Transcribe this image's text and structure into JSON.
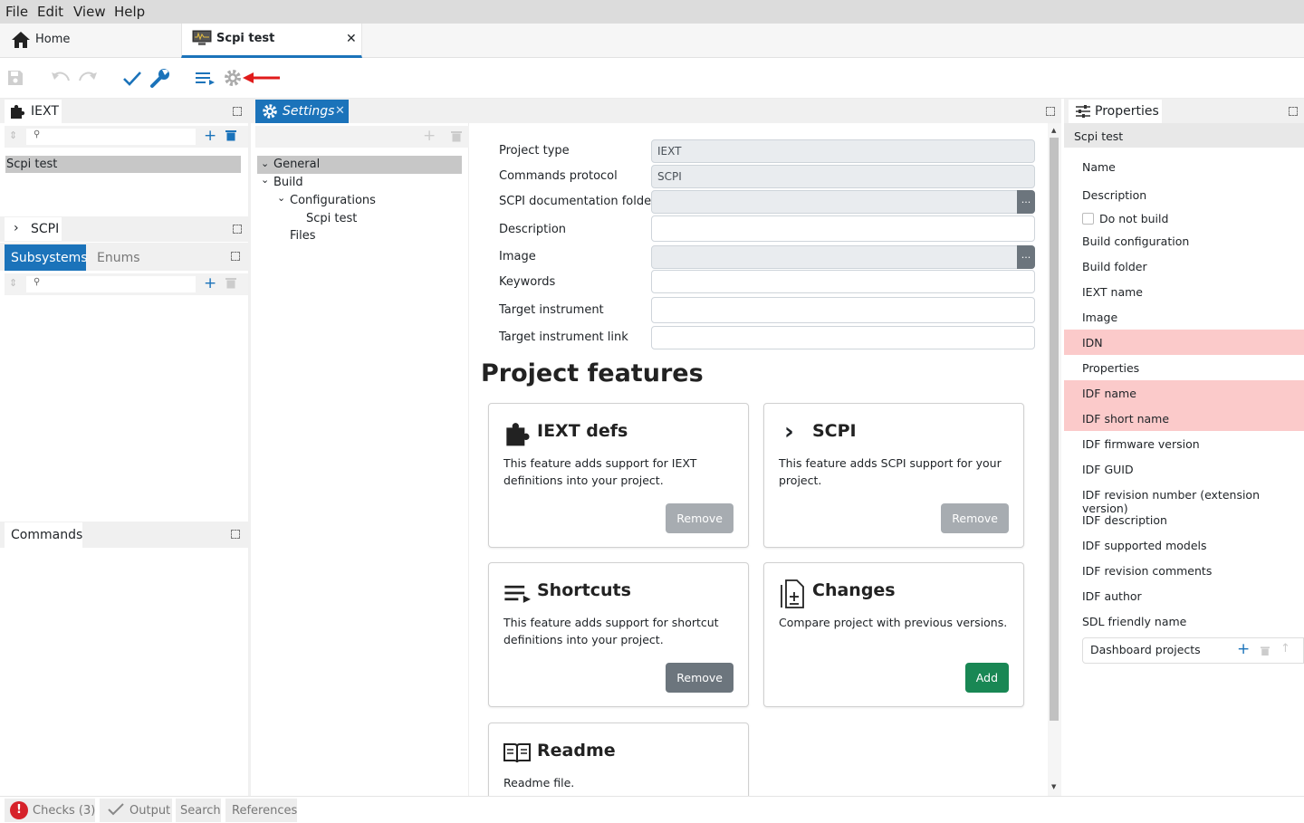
{
  "menu": [
    "File",
    "Edit",
    "View",
    "Help"
  ],
  "tabs": {
    "home": "Home",
    "scpi_test": "Scpi test"
  },
  "left": {
    "iext_title": "IEXT",
    "project_item": "Scpi test",
    "scpi_title": "SCPI",
    "subtabs": [
      "Subsystems",
      "Enums"
    ],
    "commands_title": "Commands"
  },
  "settings": {
    "tab_label": "Settings",
    "tree": {
      "general": "General",
      "build": "Build",
      "configurations": "Configurations",
      "scpi_test": "Scpi test",
      "files": "Files"
    }
  },
  "form": {
    "project_type_label": "Project type",
    "project_type_value": "IEXT",
    "commands_protocol_label": "Commands protocol",
    "commands_protocol_value": "SCPI",
    "scpi_doc_label": "SCPI documentation folder",
    "description_label": "Description",
    "image_label": "Image",
    "keywords_label": "Keywords",
    "target_instrument_label": "Target instrument",
    "target_instrument_link_label": "Target instrument link",
    "dots": "..."
  },
  "features": {
    "heading": "Project features",
    "cards": [
      {
        "title": "IEXT defs",
        "desc": "This feature adds support for IEXT definitions into your project.",
        "button": "Remove"
      },
      {
        "title": "SCPI",
        "desc": "This feature adds SCPI support for your project.",
        "button": "Remove"
      },
      {
        "title": "Shortcuts",
        "desc": "This feature adds support for shortcut definitions into your project.",
        "button": "Remove"
      },
      {
        "title": "Changes",
        "desc": "Compare project with previous versions.",
        "button": "Add"
      },
      {
        "title": "Readme",
        "desc": "Readme file."
      }
    ]
  },
  "properties": {
    "title": "Properties",
    "object": "Scpi test",
    "rows": [
      "Name",
      "Description",
      "Do not build",
      "Build configuration",
      "Build folder",
      "IEXT name",
      "Image",
      "IDN",
      "Properties",
      "IDF name",
      "IDF short name",
      "IDF firmware version",
      "IDF GUID",
      "IDF revision number (extension version)",
      "IDF description",
      "IDF supported models",
      "IDF revision comments",
      "IDF author",
      "SDL friendly name"
    ],
    "dashboard_projects": "Dashboard projects"
  },
  "bottom": {
    "checks": "Checks (3)",
    "output": "Output",
    "search": "Search",
    "references": "References",
    "checks_badge": "!"
  },
  "colors": {
    "accent": "#1b73ba",
    "error_row": "#fbcaca",
    "remove_button": "#6c757d",
    "add_button": "#198754"
  }
}
